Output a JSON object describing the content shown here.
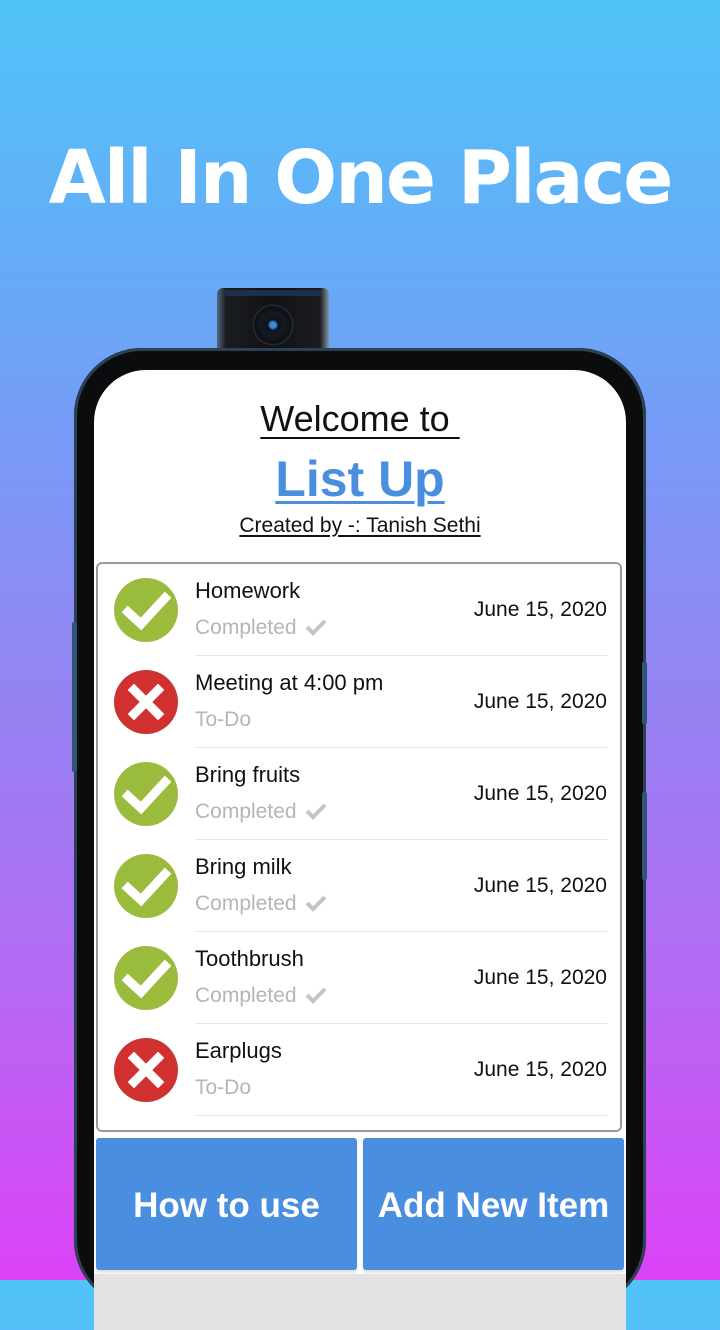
{
  "headline": "All In One Place",
  "app": {
    "welcome": "Welcome to ",
    "name": "List Up",
    "credit": "Created by -: Tanish Sethi"
  },
  "colors": {
    "accent": "#4a8ee0",
    "completed": "#9bbb3c",
    "todo": "#d03030",
    "muted_text": "#b5b5b5"
  },
  "items": [
    {
      "title": "Homework",
      "status": "Completed",
      "status_icon": "check-circle-icon",
      "completed": true,
      "date": "June 15, 2020"
    },
    {
      "title": "Meeting at 4:00 pm",
      "status": "To-Do",
      "status_icon": "x-circle-icon",
      "completed": false,
      "date": "June 15, 2020"
    },
    {
      "title": "Bring fruits",
      "status": "Completed",
      "status_icon": "check-circle-icon",
      "completed": true,
      "date": "June 15, 2020"
    },
    {
      "title": "Bring milk",
      "status": "Completed",
      "status_icon": "check-circle-icon",
      "completed": true,
      "date": "June 15, 2020"
    },
    {
      "title": "Toothbrush",
      "status": "Completed",
      "status_icon": "check-circle-icon",
      "completed": true,
      "date": "June 15, 2020"
    },
    {
      "title": "Earplugs",
      "status": "To-Do",
      "status_icon": "x-circle-icon",
      "completed": false,
      "date": "June 15, 2020"
    }
  ],
  "buttons": {
    "how_to_use": "How to use",
    "add_new_item": "Add New Item"
  }
}
